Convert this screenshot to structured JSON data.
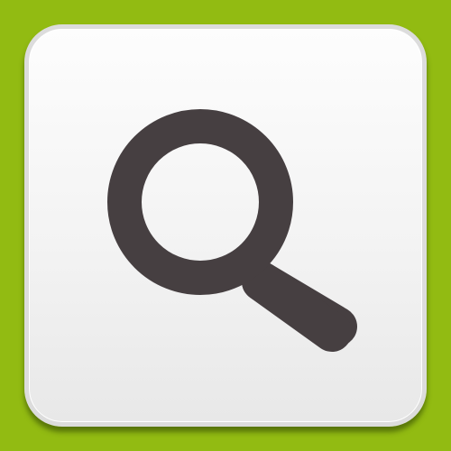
{
  "background_color": "#92bb12",
  "tile": {
    "icon": "search-icon",
    "fill_color": "#f5f5f5",
    "border_color": "#dcdcdc",
    "icon_color": "#463f41"
  }
}
